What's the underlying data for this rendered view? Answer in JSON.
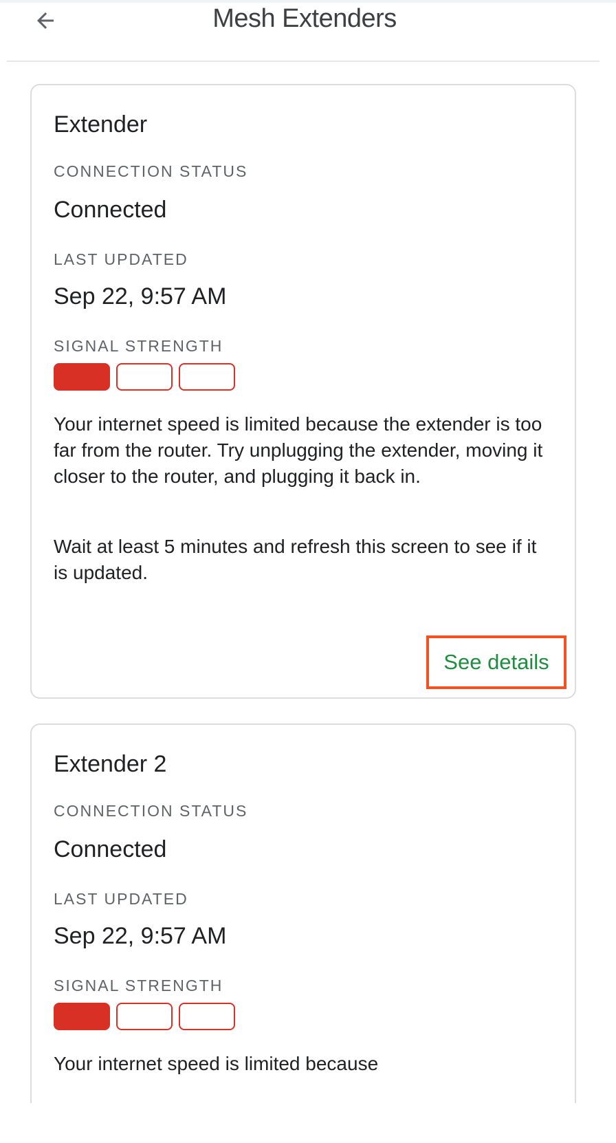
{
  "app_bar": {
    "title": "Mesh Extenders",
    "back_icon": "arrow-left-icon"
  },
  "extenders": [
    {
      "name": "Extender",
      "connection_status_label": "CONNECTION STATUS",
      "connection_status": "Connected",
      "last_updated_label": "LAST UPDATED",
      "last_updated": "Sep 22, 9:57 AM",
      "signal_strength_label": "SIGNAL STRENGTH",
      "signal_bars_filled": 1,
      "signal_bars_total": 3,
      "message_1": "Your internet speed is limited because the extender is too far from the router. Try unplugging the extender, moving it closer to the router, and plugging it back in.",
      "message_2": "Wait at least 5 minutes and refresh this screen to see if it is updated.",
      "details_label": "See details"
    },
    {
      "name": "Extender 2",
      "connection_status_label": "CONNECTION STATUS",
      "connection_status": "Connected",
      "last_updated_label": "LAST UPDATED",
      "last_updated": "Sep 22, 9:57 AM",
      "signal_strength_label": "SIGNAL STRENGTH",
      "signal_bars_filled": 1,
      "signal_bars_total": 3,
      "message_1": "Your internet speed is limited because"
    }
  ],
  "colors": {
    "signal_red": "#d93025",
    "link_green": "#1e8e3e",
    "highlight_orange": "#f4511e"
  }
}
